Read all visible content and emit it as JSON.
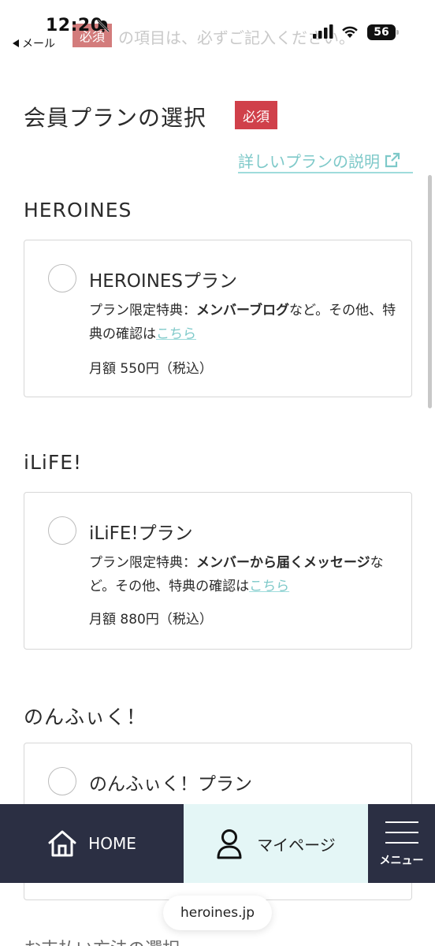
{
  "status_bar": {
    "time": "12:20",
    "back_label": "メール",
    "battery": "56"
  },
  "notice": {
    "required_tag": "必須",
    "text": "の項目は、必ずご記入ください。"
  },
  "section": {
    "title": "会員プランの選択",
    "required_badge": "必須",
    "plan_detail_link": "詳しいプランの説明"
  },
  "plans": [
    {
      "group_title": "HEROINES",
      "name": "HEROINESプラン",
      "benefit_prefix": "プラン限定特典：",
      "benefit_bold": "メンバーブログ",
      "benefit_suffix": "など。その他、特典の確認は",
      "benefit_link": "こちら",
      "price": "月額 550円（税込）"
    },
    {
      "group_title": "iLiFE!",
      "name": "iLiFE!プラン",
      "benefit_prefix": "プラン限定特典：",
      "benefit_bold": "メンバーから届くメッセージ",
      "benefit_suffix": "など。その他、特典の確認は",
      "benefit_link": "こちら",
      "price": "月額 880円（税込）"
    },
    {
      "group_title": "のんふぃく！",
      "name": "のんふぃく！プラン"
    }
  ],
  "bottom_nav": {
    "home": "HOME",
    "mypage": "マイページ",
    "menu": "メニュー"
  },
  "browser": {
    "url": "heroines.jp"
  },
  "next_section_peek": "お支払い方法の選択",
  "colors": {
    "accent_teal": "#7ec9c9",
    "required_red": "#d0404a",
    "nav_dark": "#2b2f43",
    "nav_active": "#e4f6f6"
  }
}
